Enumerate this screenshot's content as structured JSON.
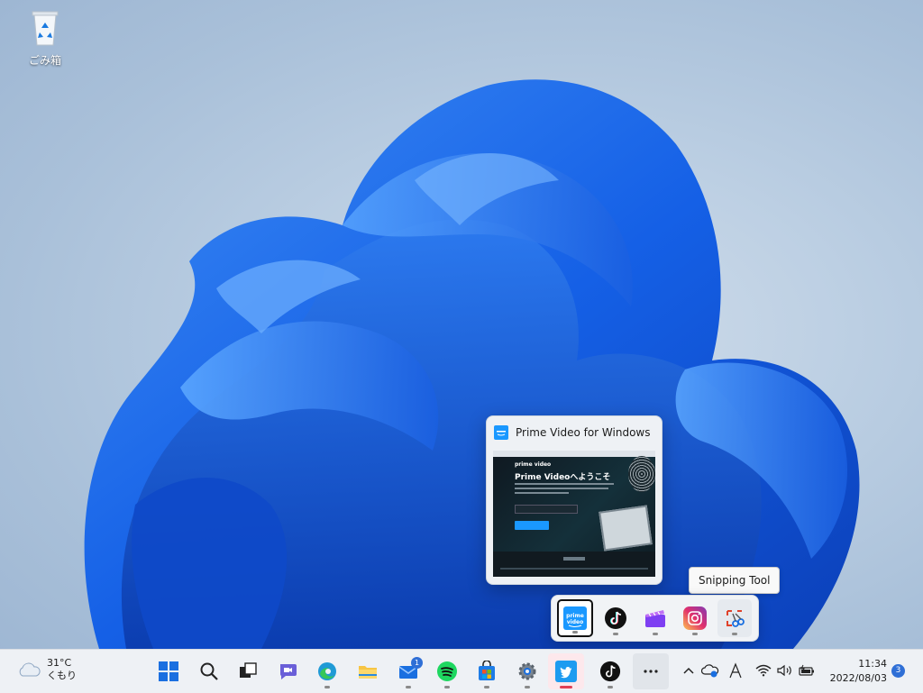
{
  "desktop": {
    "recycle_bin_label": "ごみ箱"
  },
  "preview": {
    "title": "Prime Video for Windows",
    "thumb_brand": "prime video",
    "thumb_heading": "Prime Videoへようこそ"
  },
  "tooltip": "Snipping Tool",
  "overflow_apps": [
    {
      "name": "prime-video",
      "icon": "prime-video-icon",
      "active": true
    },
    {
      "name": "tiktok",
      "icon": "tiktok-icon"
    },
    {
      "name": "clipchamp",
      "icon": "clipchamp-icon"
    },
    {
      "name": "instagram",
      "icon": "instagram-icon"
    },
    {
      "name": "snipping-tool",
      "icon": "snipping-tool-icon"
    }
  ],
  "weather": {
    "temp": "31°C",
    "condition": "くもり"
  },
  "taskbar": {
    "mail_badge": "1",
    "pinned": [
      "start",
      "search",
      "task-view",
      "teams",
      "edge",
      "file-explorer",
      "mail",
      "spotify",
      "store",
      "settings",
      "twitter",
      "tiktok",
      "more"
    ]
  },
  "clock": {
    "time": "11:34",
    "date": "2022/08/03"
  },
  "notifications": {
    "count": "3"
  },
  "colors": {
    "accent": "#1a6fe0",
    "badge": "#2f6fd6",
    "twitter": "#1d9bf0"
  }
}
